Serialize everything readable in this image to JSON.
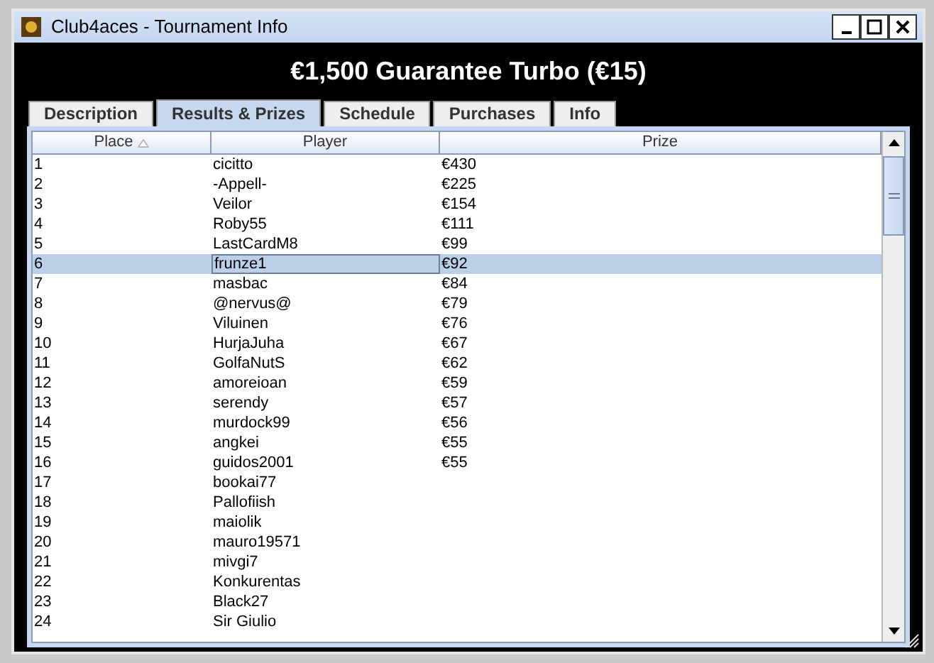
{
  "window": {
    "title": "Club4aces - Tournament Info"
  },
  "heading": "€1,500 Guarantee Turbo (€15)",
  "tabs": [
    {
      "label": "Description",
      "selected": false
    },
    {
      "label": "Results & Prizes",
      "selected": true
    },
    {
      "label": "Schedule",
      "selected": false
    },
    {
      "label": "Purchases",
      "selected": false
    },
    {
      "label": "Info",
      "selected": false
    }
  ],
  "table": {
    "columns": [
      {
        "label": "Place",
        "sorted": true
      },
      {
        "label": "Player",
        "sorted": false
      },
      {
        "label": "Prize",
        "sorted": false
      }
    ],
    "rows": [
      {
        "place": "1",
        "player": "cicitto",
        "prize": "€430",
        "selected": false
      },
      {
        "place": "2",
        "player": "-Appell-",
        "prize": "€225",
        "selected": false
      },
      {
        "place": "3",
        "player": "Veilor",
        "prize": "€154",
        "selected": false
      },
      {
        "place": "4",
        "player": "Roby55",
        "prize": "€111",
        "selected": false
      },
      {
        "place": "5",
        "player": "LastCardM8",
        "prize": "€99",
        "selected": false
      },
      {
        "place": "6",
        "player": "frunze1",
        "prize": "€92",
        "selected": true
      },
      {
        "place": "7",
        "player": "masbac",
        "prize": "€84",
        "selected": false
      },
      {
        "place": "8",
        "player": "@nervus@",
        "prize": "€79",
        "selected": false
      },
      {
        "place": "9",
        "player": "Viluinen",
        "prize": "€76",
        "selected": false
      },
      {
        "place": "10",
        "player": "HurjaJuha",
        "prize": "€67",
        "selected": false
      },
      {
        "place": "11",
        "player": "GolfaNutS",
        "prize": "€62",
        "selected": false
      },
      {
        "place": "12",
        "player": "amoreioan",
        "prize": "€59",
        "selected": false
      },
      {
        "place": "13",
        "player": "serendy",
        "prize": "€57",
        "selected": false
      },
      {
        "place": "14",
        "player": "murdock99",
        "prize": "€56",
        "selected": false
      },
      {
        "place": "15",
        "player": "angkei",
        "prize": "€55",
        "selected": false
      },
      {
        "place": "16",
        "player": "guidos2001",
        "prize": "€55",
        "selected": false
      },
      {
        "place": "17",
        "player": "bookai77",
        "selected": false
      },
      {
        "place": "18",
        "player": "Pallofiish",
        "selected": false
      },
      {
        "place": "19",
        "player": "maiolik",
        "selected": false
      },
      {
        "place": "20",
        "player": "mauro19571",
        "selected": false
      },
      {
        "place": "21",
        "player": "mivgi7",
        "selected": false
      },
      {
        "place": "22",
        "player": "Konkurentas",
        "selected": false
      },
      {
        "place": "23",
        "player": "Black27",
        "selected": false
      },
      {
        "place": "24",
        "player": "Sir Giulio",
        "selected": false
      }
    ]
  }
}
